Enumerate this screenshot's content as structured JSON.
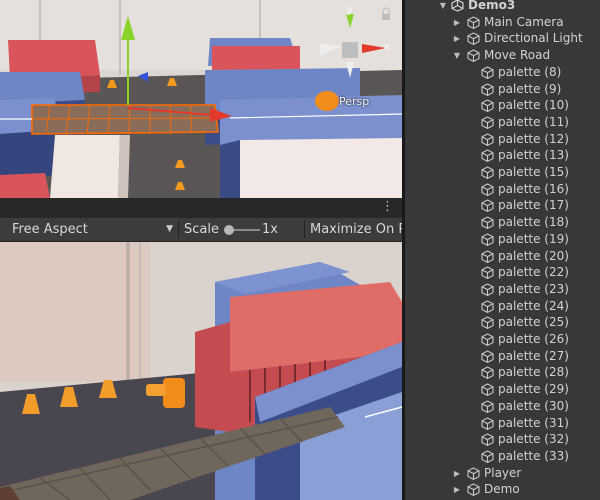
{
  "scene_view": {
    "persp_label": "Persp",
    "gizmo": {
      "y_label": "y",
      "x_label": "x"
    }
  },
  "game_toolbar": {
    "aspect": "Free Aspect",
    "scale_label": "Scale",
    "scale_value": "1x",
    "maximize_label": "Maximize On Play"
  },
  "hierarchy": {
    "scene_name": "Demo3",
    "top_items": [
      "Main Camera",
      "Directional Light"
    ],
    "parent": "Move Road",
    "children": [
      "palette (8)",
      "palette (9)",
      "palette (10)",
      "palette (11)",
      "palette (12)",
      "palette (13)",
      "palette (15)",
      "palette (16)",
      "palette (17)",
      "palette (18)",
      "palette (19)",
      "palette (20)",
      "palette (22)",
      "palette (23)",
      "palette (24)",
      "palette (25)",
      "palette (26)",
      "palette (27)",
      "palette (28)",
      "palette (29)",
      "palette (30)",
      "palette (31)",
      "palette (32)",
      "palette (33)"
    ],
    "bottom_items": [
      "Player",
      "Demo"
    ]
  },
  "colors": {
    "panel_bg": "#383838",
    "toolbar_bg": "#3c3c3c",
    "text": "#d2d2d2",
    "selection_outline": "#ff6a00",
    "gizmo_x": "#e23b2e",
    "gizmo_y": "#8ad32a"
  }
}
